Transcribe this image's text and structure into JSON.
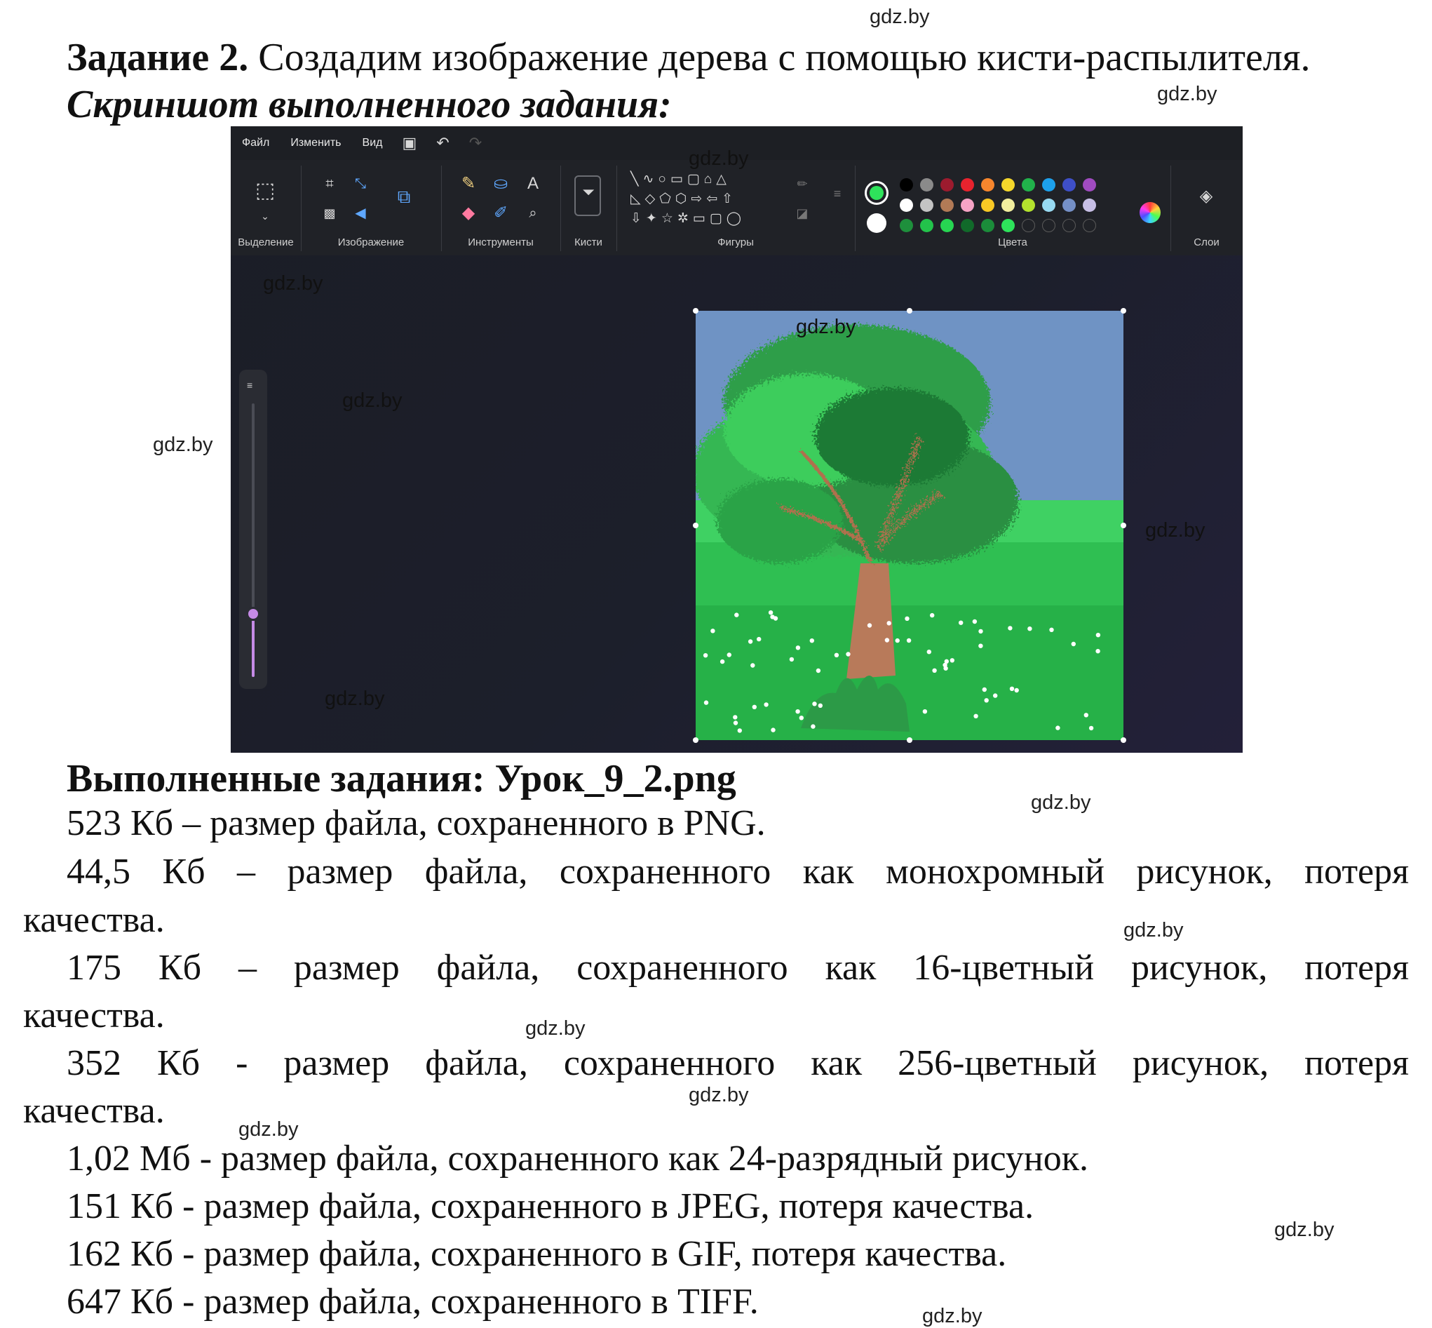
{
  "task": {
    "label": "Задание 2.",
    "text": " Создадим изображение дерева с помощью кисти-распылителя.",
    "screenshot_caption": "Скриншот выполненного задания:"
  },
  "paint": {
    "menu": [
      "Файл",
      "Изменить",
      "Вид"
    ],
    "groups": [
      "Выделение",
      "Изображение",
      "Инструменты",
      "Кисти",
      "Фигуры",
      "Цвета",
      "Слои"
    ],
    "palette_row1": [
      "#000000",
      "#8a8a8a",
      "#9c1b2e",
      "#e8232e",
      "#f7862d",
      "#f5d72b",
      "#21b24b",
      "#1da1ec",
      "#3e4fc8",
      "#a04bc0"
    ],
    "palette_row2": [
      "#ffffff",
      "#c4c4c4",
      "#b27a56",
      "#f6a3c5",
      "#f8c825",
      "#f2ee9e",
      "#b3e22e",
      "#98daf2",
      "#7590c7",
      "#c7bfe6"
    ],
    "palette_row3": [
      "#1e8f3c",
      "#23c34b",
      "#27d652",
      "#116a2a",
      "#1b8c3a",
      "#2ee35b"
    ],
    "primary_color": "#2ee35b",
    "secondary_color": "#ffffff",
    "brush_size_fraction": 0.23
  },
  "results": {
    "heading": "Выполненные задания: Урок_9_2.png",
    "line1": "523 Кб – размер файла, сохраненного в PNG.",
    "line2_words": [
      "44,5",
      "Кб",
      "–",
      "размер",
      "файла,",
      "сохраненного",
      "как",
      "монохромный",
      "рисунок,",
      "потеря"
    ],
    "line2_cont": "качества.",
    "line3_words": [
      "175",
      "Кб",
      "–",
      "размер",
      "файла,",
      "сохраненного",
      "как",
      "16-цветный",
      "рисунок,",
      "потеря"
    ],
    "line3_cont": "качества.",
    "line4_words": [
      "352",
      "Кб",
      "-",
      "размер",
      "файла,",
      "сохраненного",
      "как",
      "256-цветный",
      "рисунок,",
      "потеря"
    ],
    "line4_cont": "качества.",
    "line5": "1,02 Мб - размер файла, сохраненного как 24-разрядный рисунок.",
    "line6": "151 Кб - размер файла, сохраненного в JPEG, потеря качества.",
    "line7": "162 Кб - размер файла, сохраненного в GIF, потеря качества.",
    "line8": "647 Кб - размер файла, сохраненного в TIFF."
  },
  "watermark": "gdz.by"
}
